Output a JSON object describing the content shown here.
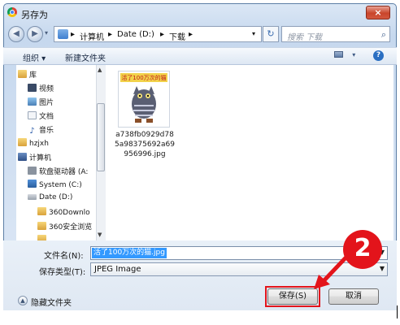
{
  "window": {
    "title": "另存为",
    "close_label": "×"
  },
  "address": {
    "crumbs": [
      "计算机",
      "Date (D:)",
      "下载"
    ],
    "separator": "▸",
    "dropdown_glyph": "▾",
    "refresh_glyph": "↻"
  },
  "search": {
    "placeholder": "搜索 下载"
  },
  "toolbar": {
    "organize": "组织 ▾",
    "new_folder": "新建文件夹",
    "help": "?"
  },
  "nav": {
    "items": [
      {
        "label": "库",
        "icon": "library-icon",
        "indent": 0
      },
      {
        "label": "视频",
        "icon": "video-icon",
        "indent": 1
      },
      {
        "label": "图片",
        "icon": "pictures-icon",
        "indent": 1
      },
      {
        "label": "文档",
        "icon": "documents-icon",
        "indent": 1
      },
      {
        "label": "音乐",
        "icon": "music-icon",
        "indent": 1
      },
      {
        "label": "hzjxh",
        "icon": "user-folder-icon",
        "indent": 0
      },
      {
        "label": "计算机",
        "icon": "computer-icon",
        "indent": 0
      },
      {
        "label": "软盘驱动器 (A:",
        "icon": "floppy-icon",
        "indent": 1
      },
      {
        "label": "System (C:)",
        "icon": "drive-icon",
        "indent": 1
      },
      {
        "label": "Date (D:)",
        "icon": "drive-icon",
        "indent": 1
      },
      {
        "label": "360Downlo",
        "icon": "folder-icon",
        "indent": 2
      },
      {
        "label": "360安全浏览",
        "icon": "folder-icon",
        "indent": 2
      }
    ]
  },
  "file": {
    "name": "a738fb0929d785a98375692a69956996.jpg",
    "thumb_title": "活了100万次的猫"
  },
  "form": {
    "filename_label": "文件名(N):",
    "filename_value": "活了100万次的猫.jpg",
    "filetype_label": "保存类型(T):",
    "filetype_value": "JPEG Image"
  },
  "footer": {
    "hide_folders": "隐藏文件夹",
    "save_label": "保存(S)",
    "cancel_label": "取消"
  },
  "annotation": {
    "step": "2"
  },
  "colors": {
    "annotation_red": "#e3141b",
    "selection_blue": "#3399ff",
    "chrome_blue": "#c6d8ee"
  }
}
